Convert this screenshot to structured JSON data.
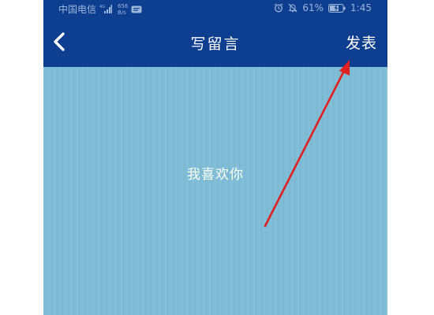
{
  "status_bar": {
    "carrier": "中国电信",
    "network_type": "4G",
    "net_speed_value": "656",
    "net_speed_unit": "B/s",
    "battery_percent": "61%",
    "time": "1:45",
    "icons": [
      "signal-icon",
      "message-icon",
      "alarm-clock-icon",
      "mute-bell-icon",
      "battery-charging-icon"
    ]
  },
  "nav_bar": {
    "back_icon": "chevron-left-icon",
    "title": "写留言",
    "publish_label": "发表"
  },
  "content": {
    "message_text": "我喜欢你"
  },
  "annotation": {
    "icon": "red-arrow-icon",
    "color": "#e02020"
  },
  "colors": {
    "header": "#0d3e8f",
    "background": "#7fbdd6",
    "text": "#ffffff"
  }
}
